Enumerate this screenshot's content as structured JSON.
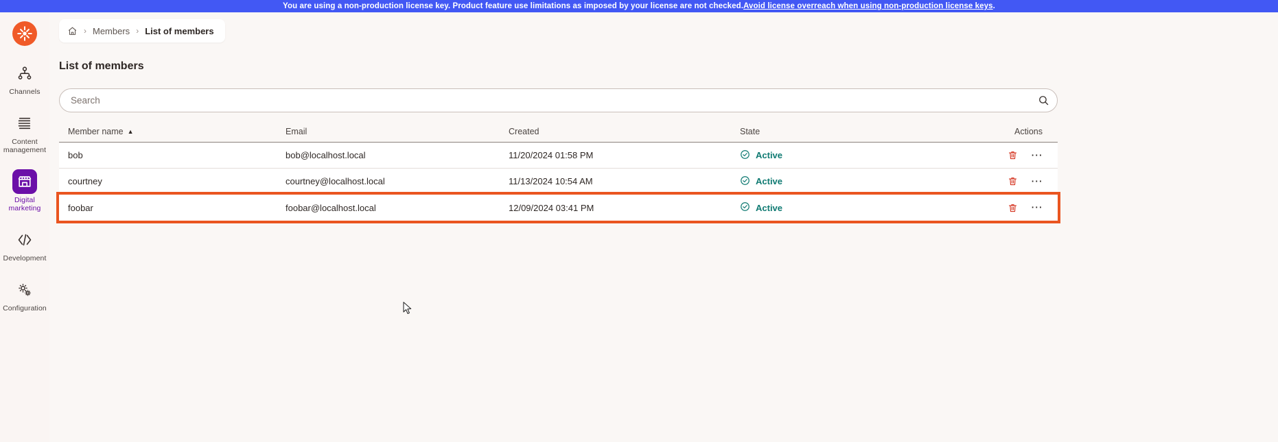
{
  "license_banner": {
    "text": "You are using a non-production license key. Product feature use limitations as imposed by your license are not checked. ",
    "link_text": "Avoid license overreach when using non-production license keys",
    "trailing": ".",
    "background_color": "#4258f4",
    "text_color": "#ffffff"
  },
  "sidebar": {
    "logo_name": "xperience-logo",
    "accent_color": "#f05a28",
    "active_color": "#6b0fa8",
    "items": [
      {
        "label": "Channels",
        "icon": "channels-icon",
        "active": false
      },
      {
        "label": "Content\nmanagement",
        "label_line1": "Content",
        "label_line2": "management",
        "icon": "content-management-icon",
        "active": false
      },
      {
        "label": "Digital marketing",
        "label_line1": "Digital",
        "label_line2": "marketing",
        "icon": "digital-marketing-icon",
        "active": true
      },
      {
        "label": "Development",
        "label_line1": "Development",
        "label_line2": "",
        "icon": "development-icon",
        "active": false
      },
      {
        "label": "Configuration",
        "label_line1": "Configuration",
        "label_line2": "",
        "icon": "configuration-icon",
        "active": false
      }
    ]
  },
  "breadcrumb": {
    "home_icon": "home-icon",
    "separator": "›",
    "items": [
      {
        "label": "Members",
        "current": false
      },
      {
        "label": "List of members",
        "current": true
      }
    ]
  },
  "page": {
    "title": "List of members"
  },
  "search": {
    "placeholder": "Search",
    "value": "",
    "icon": "search-icon"
  },
  "table": {
    "columns": [
      {
        "key": "name",
        "label": "Member name",
        "sorted": true,
        "sort_direction": "asc",
        "sort_glyph": "▲"
      },
      {
        "key": "email",
        "label": "Email",
        "sorted": false
      },
      {
        "key": "created",
        "label": "Created",
        "sorted": false
      },
      {
        "key": "state",
        "label": "State",
        "sorted": false
      },
      {
        "key": "actions",
        "label": "Actions",
        "sorted": false
      }
    ],
    "rows": [
      {
        "name": "bob",
        "email": "bob@localhost.local",
        "created": "11/20/2024 01:58 PM",
        "state": "Active",
        "state_icon": "check-circle-icon",
        "highlighted": false,
        "delete_icon": "trash-icon",
        "more_icon": "ellipsis-icon"
      },
      {
        "name": "courtney",
        "email": "courtney@localhost.local",
        "created": "11/13/2024 10:54 AM",
        "state": "Active",
        "state_icon": "check-circle-icon",
        "highlighted": false,
        "delete_icon": "trash-icon",
        "more_icon": "ellipsis-icon"
      },
      {
        "name": "foobar",
        "email": "foobar@localhost.local",
        "created": "12/09/2024 03:41 PM",
        "state": "Active",
        "state_icon": "check-circle-icon",
        "highlighted": true,
        "delete_icon": "trash-icon",
        "more_icon": "ellipsis-icon"
      }
    ],
    "state_color": "#0f7a72",
    "highlight_color": "#ea5520"
  }
}
